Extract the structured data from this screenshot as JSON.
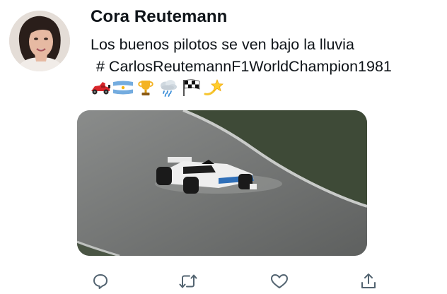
{
  "tweet": {
    "author_name": "Cora Reutemann",
    "text_line1": "Los buenos pilotos se ven bajo la lluvia",
    "hashtag": "# CarlosReutemannF1WorldChampion1981",
    "emojis": [
      "race-car",
      "argentina-flag",
      "trophy",
      "rain-cloud",
      "checkered-flag",
      "dizzy-star"
    ]
  },
  "media": {
    "description_icon": "f1-car-in-rain-video"
  },
  "actions": [
    "reply-icon",
    "retweet-icon",
    "like-icon",
    "share-icon"
  ],
  "colors": {
    "text": "#0f1419",
    "icon": "#536471",
    "background": "#ffffff"
  }
}
